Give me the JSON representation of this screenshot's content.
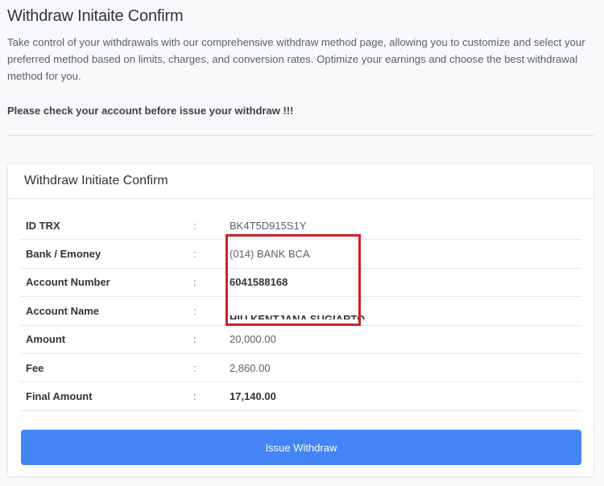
{
  "page": {
    "title": "Withdraw Initaite Confirm",
    "intro": "Take control of your withdrawals with our comprehensive withdraw method page, allowing you to customize and select your preferred method based on limits, charges, and conversion rates. Optimize your earnings and choose the best withdrawal method for you.",
    "warning": "Please check your account before issue your withdraw !!!"
  },
  "card": {
    "title": "Withdraw Initiate Confirm",
    "separator": ":",
    "rows": [
      {
        "label": "ID TRX",
        "value": "BK4T5D915S1Y"
      },
      {
        "label": "Bank / Emoney",
        "value": "(014) BANK BCA"
      },
      {
        "label": "Account Number",
        "value": "6041588168"
      },
      {
        "label": "Account Name",
        "value": "HIU KENTJANA SUGIARTO"
      },
      {
        "label": "Amount",
        "value": "20,000.00"
      },
      {
        "label": "Fee",
        "value": "2,860.00"
      },
      {
        "label": "Final Amount",
        "value": "17,140.00"
      }
    ],
    "button_label": "Issue Withdraw"
  },
  "colors": {
    "primary_button": "#4385f5",
    "highlight_annotation": "#d0202a"
  }
}
